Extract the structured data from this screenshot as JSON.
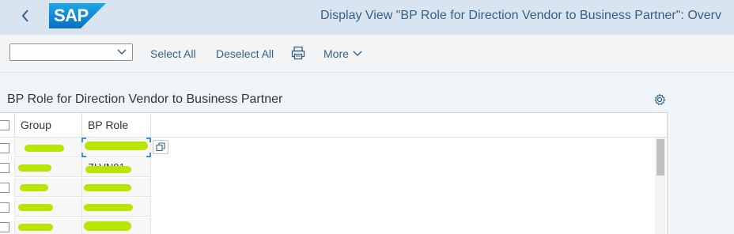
{
  "shell": {
    "title": "Display View \"BP Role for Direction Vendor to Business Partner\": Overv",
    "logo_text": "SAP",
    "colors": {
      "shell_bg": "#d8e4ef",
      "logo_blue": "#1a8ad6",
      "accent": "#346187"
    }
  },
  "toolbar": {
    "dropdown_value": "",
    "select_all": "Select All",
    "deselect_all": "Deselect All",
    "print_icon": "printer-icon",
    "more": "More"
  },
  "section": {
    "title": "BP Role for Direction Vendor to Business Partner",
    "settings_icon": "gear-icon"
  },
  "table": {
    "columns": [
      "Group",
      "BP Role"
    ],
    "rows": [
      {
        "group": "",
        "role": ""
      },
      {
        "group": "",
        "role": "ZLVN01"
      },
      {
        "group": "",
        "role": ""
      },
      {
        "group": "",
        "role": ""
      },
      {
        "group": "",
        "role": ""
      }
    ],
    "redaction_color": "#b9e600"
  }
}
